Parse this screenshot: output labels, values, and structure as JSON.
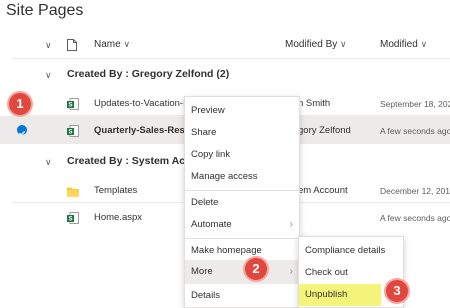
{
  "page_title": "Site Pages",
  "columns": {
    "name": "Name",
    "modified_by": "Modified By",
    "modified": "Modified"
  },
  "groups": [
    {
      "label": "Created By : Gregory Zelfond (2)"
    },
    {
      "label": "Created By : System Acco"
    }
  ],
  "rows": [
    {
      "name": "Updates-to-Vacation-P",
      "modified_by": "n Smith",
      "modified": "September 18, 2020"
    },
    {
      "name": "Quarterly-Sales-Result",
      "modified_by": "gory Zelfond",
      "modified": "A few seconds ago"
    },
    {
      "name": "Templates",
      "modified_by": "em Account",
      "modified": "December 12, 2019"
    },
    {
      "name": "Home.aspx",
      "modified_by": "",
      "modified": "A few seconds ago"
    }
  ],
  "context_menu": {
    "items": [
      "Preview",
      "Share",
      "Copy link",
      "Manage access",
      "Delete",
      "Automate",
      "Make homepage",
      "More",
      "Details"
    ]
  },
  "submenu": {
    "items": [
      "Compliance details",
      "Check out",
      "Unpublish"
    ]
  },
  "steps": [
    "1",
    "2",
    "3"
  ],
  "colors": {
    "accent": "#0078d4",
    "highlight": "#f4f47a",
    "badge": "#e0483f",
    "excel_green": "#217346"
  }
}
